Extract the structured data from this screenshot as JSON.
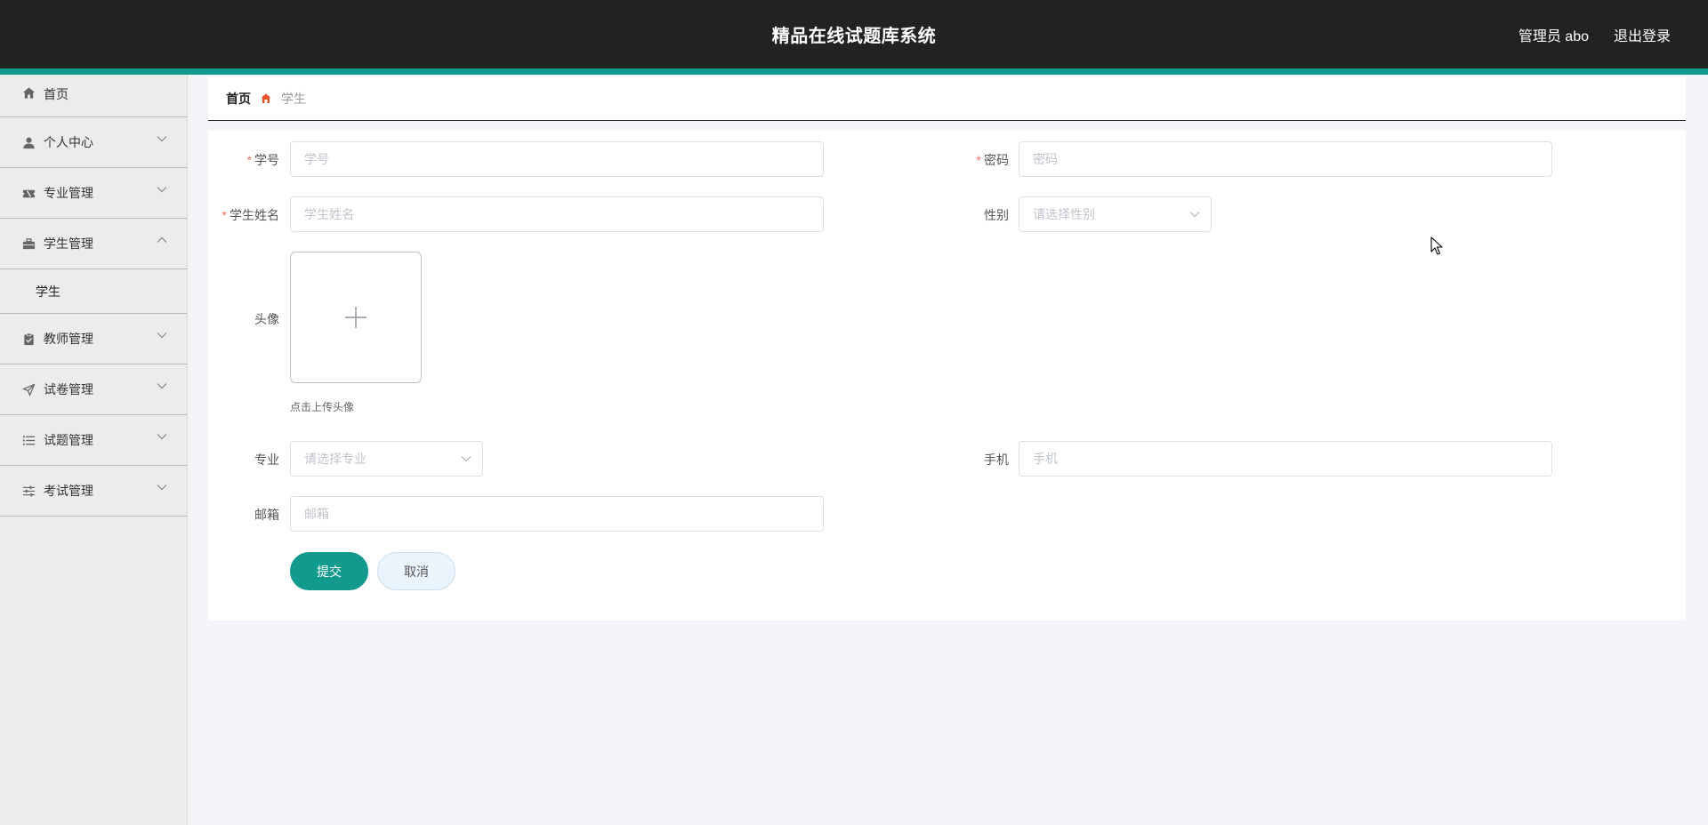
{
  "header": {
    "title": "精品在线试题库系统",
    "user": "管理员 abo",
    "logout": "退出登录",
    "accent_color": "#129a8f"
  },
  "sidebar": {
    "items": [
      {
        "label": "首页",
        "icon": "home-icon"
      },
      {
        "label": "个人中心",
        "icon": "user-icon",
        "expanded": false
      },
      {
        "label": "专业管理",
        "icon": "ticket-icon",
        "expanded": false
      },
      {
        "label": "学生管理",
        "icon": "briefcase-icon",
        "expanded": true,
        "children": [
          {
            "label": "学生"
          }
        ]
      },
      {
        "label": "教师管理",
        "icon": "clipboard-icon",
        "expanded": false
      },
      {
        "label": "试卷管理",
        "icon": "send-icon",
        "expanded": false
      },
      {
        "label": "试题管理",
        "icon": "list-icon",
        "expanded": false
      },
      {
        "label": "考试管理",
        "icon": "sliders-icon",
        "expanded": false
      }
    ]
  },
  "breadcrumb": {
    "home": "首页",
    "current": "学生",
    "separator_icon": "home-badge-icon"
  },
  "form": {
    "student_id": {
      "label": "学号",
      "placeholder": "学号",
      "required": true
    },
    "password": {
      "label": "密码",
      "placeholder": "密码",
      "required": true
    },
    "student_name": {
      "label": "学生姓名",
      "placeholder": "学生姓名",
      "required": true
    },
    "gender": {
      "label": "性别",
      "placeholder": "请选择性别"
    },
    "avatar": {
      "label": "头像",
      "tip": "点击上传头像"
    },
    "major": {
      "label": "专业",
      "placeholder": "请选择专业"
    },
    "phone": {
      "label": "手机",
      "placeholder": "手机"
    },
    "email": {
      "label": "邮箱",
      "placeholder": "邮箱"
    },
    "submit": "提交",
    "cancel": "取消"
  }
}
